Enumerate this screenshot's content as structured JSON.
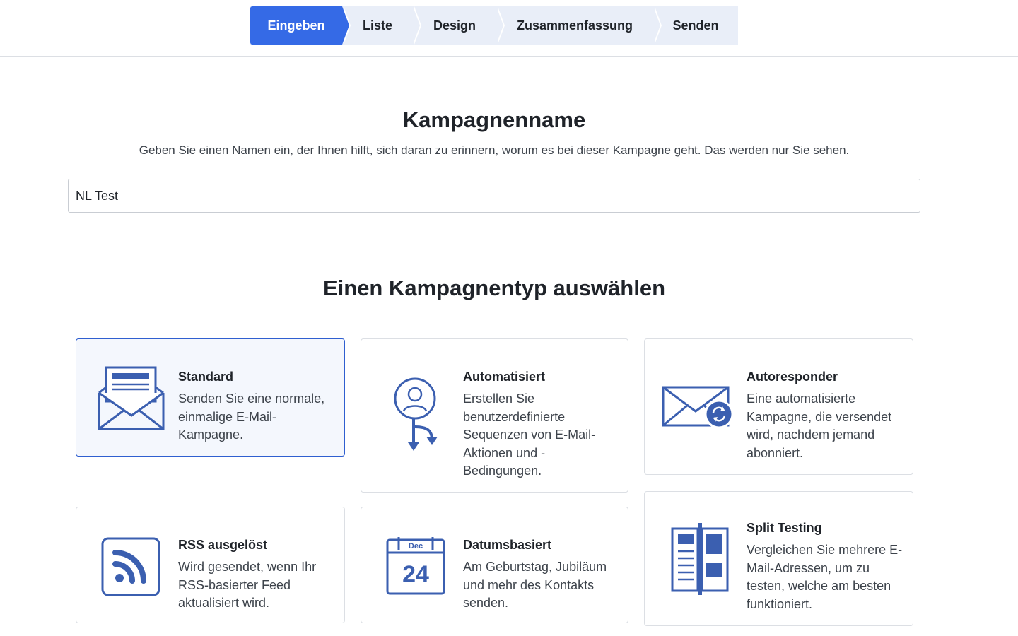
{
  "stepper": {
    "steps": [
      "Eingeben",
      "Liste",
      "Design",
      "Zusammenfassung",
      "Senden"
    ],
    "active_index": 0
  },
  "name_section": {
    "title": "Kampagnenname",
    "description": "Geben Sie einen Namen ein, der Ihnen hilft, sich daran zu erinnern, worum es bei dieser Kampagne geht. Das werden nur Sie sehen.",
    "input_value": "NL Test"
  },
  "type_section": {
    "title": "Einen Kampagnentyp auswählen",
    "selected_card": "Standard",
    "cards": [
      {
        "title": "Standard",
        "description": "Senden Sie eine normale, einmalige E-Mail-Kampagne.",
        "icon": "envelope-letter-icon"
      },
      {
        "title": "Automatisiert",
        "description": "Erstellen Sie benutzerdefinierte Sequenzen von E-Mail-Aktionen und -Bedingungen.",
        "icon": "user-flow-icon"
      },
      {
        "title": "Autoresponder",
        "description": "Eine automatisierte Kampagne, die versendet wird, nachdem jemand abonniert.",
        "icon": "envelope-refresh-icon"
      },
      {
        "title": "RSS ausgelöst",
        "description": "Wird gesendet, wenn Ihr RSS-basierter Feed aktualisiert wird.",
        "icon": "rss-icon"
      },
      {
        "title": "Datumsbasiert",
        "description": "Am Geburtstag, Jubiläum und mehr des Kontakts senden.",
        "icon": "calendar-icon",
        "calendar_month": "Dec",
        "calendar_day": "24"
      },
      {
        "title": "Split Testing",
        "description": "Vergleichen Sie mehrere E-Mail-Adressen, um zu testen, welche am besten funktioniert.",
        "icon": "split-layout-icon"
      }
    ]
  },
  "colors": {
    "accent": "#356ae6",
    "icon_blue": "#3b5fb0",
    "selected_border": "#2f5fd0",
    "stepper_bg": "#e9eef8"
  }
}
